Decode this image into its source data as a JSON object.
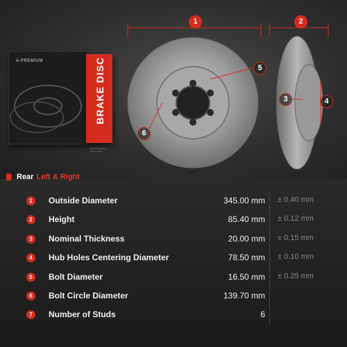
{
  "box": {
    "brand": "A-PREMIUM",
    "product": "BRAKE DISC",
    "fine_print": "Precision Braking Performance"
  },
  "markers": [
    "1",
    "2",
    "3",
    "4",
    "5",
    "6"
  ],
  "header": {
    "rear": "Rear",
    "side": "Left & Right"
  },
  "specs": [
    {
      "num": "1",
      "label": "Outside Diameter",
      "value": "345.00 mm",
      "tol": "± 0.40 mm"
    },
    {
      "num": "2",
      "label": "Height",
      "value": "85.40 mm",
      "tol": "± 0.12 mm"
    },
    {
      "num": "3",
      "label": "Nominal Thickness",
      "value": "20.00 mm",
      "tol": "± 0.15 mm"
    },
    {
      "num": "4",
      "label": "Hub Holes Centering Diameter",
      "value": "78.50 mm",
      "tol": "± 0.10 mm"
    },
    {
      "num": "5",
      "label": "Bolt Diameter",
      "value": "16.50 mm",
      "tol": "± 0.25 mm"
    },
    {
      "num": "6",
      "label": "Bolt Circle Diameter",
      "value": "139.70 mm",
      "tol": ""
    },
    {
      "num": "7",
      "label": "Number of Studs",
      "value": "6",
      "tol": ""
    }
  ],
  "colors": {
    "accent": "#d52c1f",
    "background": "#1a1a1a"
  }
}
